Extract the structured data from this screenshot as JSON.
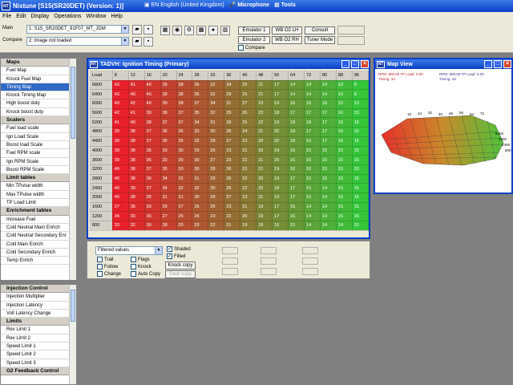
{
  "app": {
    "title": "Nistune [S15(SR20DET) (Version: 1)]",
    "icon": "NT"
  },
  "langbar": {
    "language": "EN English (United Kingdom)",
    "microphone": "Microphone",
    "tools": "Tools"
  },
  "menu": [
    "File",
    "Edit",
    "Display",
    "Operations",
    "Window",
    "Help"
  ],
  "toolbar": {
    "main_label": "Main",
    "compare_label": "Compare",
    "main_value": "1: S15_SR20DET_91F07_MT_JDM",
    "compare_value": "2: Image not loaded",
    "emulator1": "Emulator 1",
    "emulator2": "Emulator 2",
    "wbo2lh": "WB O2 LH",
    "wbo2rh": "WB O2 RH",
    "consult": "Consult",
    "tuner_mode": "Tuner Mode",
    "compare_check": "Compare"
  },
  "sidebar_top": [
    {
      "type": "head",
      "label": "Maps"
    },
    {
      "type": "item",
      "label": "Fuel Map"
    },
    {
      "type": "item",
      "label": "Knock Fuel Map"
    },
    {
      "type": "sel",
      "label": "Timing Map"
    },
    {
      "type": "item",
      "label": "Knock Timing Map"
    },
    {
      "type": "item",
      "label": "High boost duty"
    },
    {
      "type": "item",
      "label": "Knock boost duty"
    },
    {
      "type": "head",
      "label": "Scalers"
    },
    {
      "type": "item",
      "label": "Fuel load scale"
    },
    {
      "type": "item",
      "label": "Ign Load Scale"
    },
    {
      "type": "item",
      "label": "Boost load Scale"
    },
    {
      "type": "item",
      "label": "Fuel RPM scale"
    },
    {
      "type": "item",
      "label": "Ign RPM Scale"
    },
    {
      "type": "item",
      "label": "Boost RPM Scale"
    },
    {
      "type": "head",
      "label": "Limit tables"
    },
    {
      "type": "item",
      "label": "Min TPulse width"
    },
    {
      "type": "item",
      "label": "Max TPulse width"
    },
    {
      "type": "item",
      "label": "TP Load Limit"
    },
    {
      "type": "head",
      "label": "Enrichment tables"
    },
    {
      "type": "item",
      "label": "Increase Fuel"
    },
    {
      "type": "item",
      "label": "Cold Neutral Main Enrich"
    },
    {
      "type": "item",
      "label": "Cold Neutral Secondary Enr"
    },
    {
      "type": "item",
      "label": "Cold Main Enrich"
    },
    {
      "type": "item",
      "label": "Cold Secondary Enrich"
    },
    {
      "type": "item",
      "label": "Temp Enrich"
    }
  ],
  "sidebar_bottom": [
    {
      "type": "head",
      "label": "Injection Control"
    },
    {
      "type": "item",
      "label": "Injection Multiplier"
    },
    {
      "type": "item",
      "label": "Injection Latency"
    },
    {
      "type": "item",
      "label": "Volt Latency Change"
    },
    {
      "type": "head",
      "label": "Limits"
    },
    {
      "type": "item",
      "label": "Rev Limit 1"
    },
    {
      "type": "item",
      "label": "Rev Limit 2"
    },
    {
      "type": "item",
      "label": "Speed Limit 1"
    },
    {
      "type": "item",
      "label": "Speed Limit 2"
    },
    {
      "type": "item",
      "label": "Speed Limit 3"
    },
    {
      "type": "head",
      "label": "O2 Feedback Control"
    }
  ],
  "timing": {
    "title": "TADVH: Ignition Timing (Primary)",
    "corner": "Load",
    "cols": [
      "8",
      "12",
      "16",
      "20",
      "24",
      "28",
      "32",
      "36",
      "40",
      "48",
      "56",
      "64",
      "72",
      "80",
      "88",
      "96",
      "104"
    ],
    "rows": [
      {
        "rpm": "6800",
        "v": [
          "43",
          "41",
          "40",
          "39",
          "38",
          "36",
          "32",
          "34",
          "25",
          "21",
          "17",
          "14",
          "14",
          "14",
          "10",
          "8"
        ]
      },
      {
        "rpm": "6400",
        "v": [
          "43",
          "40",
          "40",
          "39",
          "38",
          "36",
          "32",
          "29",
          "25",
          "21",
          "17",
          "14",
          "14",
          "14",
          "10",
          "8"
        ]
      },
      {
        "rpm": "6000",
        "v": [
          "43",
          "42",
          "40",
          "39",
          "38",
          "37",
          "34",
          "31",
          "27",
          "23",
          "19",
          "16",
          "16",
          "16",
          "15",
          "13"
        ]
      },
      {
        "rpm": "5600",
        "v": [
          "42",
          "41",
          "39",
          "38",
          "37",
          "35",
          "32",
          "29",
          "26",
          "23",
          "18",
          "17",
          "17",
          "17",
          "16",
          "15"
        ]
      },
      {
        "rpm": "5200",
        "v": [
          "41",
          "40",
          "38",
          "37",
          "37",
          "34",
          "31",
          "28",
          "25",
          "22",
          "19",
          "18",
          "18",
          "17",
          "16",
          "15"
        ]
      },
      {
        "rpm": "4800",
        "v": [
          "39",
          "38",
          "37",
          "36",
          "36",
          "33",
          "30",
          "28",
          "24",
          "21",
          "20",
          "18",
          "17",
          "17",
          "16",
          "15"
        ]
      },
      {
        "rpm": "4400",
        "v": [
          "39",
          "38",
          "37",
          "36",
          "35",
          "32",
          "29",
          "27",
          "23",
          "20",
          "20",
          "18",
          "16",
          "17",
          "16",
          "15"
        ]
      },
      {
        "rpm": "4000",
        "v": [
          "39",
          "38",
          "36",
          "33",
          "30",
          "29",
          "25",
          "23",
          "21",
          "20",
          "19",
          "16",
          "15",
          "15",
          "15",
          "15"
        ]
      },
      {
        "rpm": "3600",
        "v": [
          "39",
          "38",
          "36",
          "33",
          "30",
          "30",
          "27",
          "23",
          "22",
          "21",
          "20",
          "16",
          "16",
          "15",
          "15",
          "15"
        ]
      },
      {
        "rpm": "3200",
        "v": [
          "40",
          "38",
          "37",
          "35",
          "33",
          "30",
          "28",
          "26",
          "22",
          "21",
          "19",
          "16",
          "16",
          "15",
          "15",
          "15"
        ]
      },
      {
        "rpm": "2800",
        "v": [
          "40",
          "38",
          "36",
          "34",
          "32",
          "31",
          "29",
          "26",
          "22",
          "20",
          "19",
          "17",
          "15",
          "15",
          "15",
          "15"
        ]
      },
      {
        "rpm": "2400",
        "v": [
          "40",
          "39",
          "37",
          "34",
          "32",
          "32",
          "30",
          "26",
          "22",
          "20",
          "18",
          "17",
          "15",
          "14",
          "15",
          "15"
        ]
      },
      {
        "rpm": "2000",
        "v": [
          "40",
          "38",
          "35",
          "31",
          "31",
          "30",
          "29",
          "27",
          "23",
          "21",
          "19",
          "17",
          "15",
          "14",
          "15",
          "15"
        ]
      },
      {
        "rpm": "1600",
        "v": [
          "37",
          "36",
          "33",
          "29",
          "27",
          "26",
          "25",
          "23",
          "21",
          "19",
          "17",
          "15",
          "14",
          "14",
          "15",
          "15"
        ]
      },
      {
        "rpm": "1200",
        "v": [
          "34",
          "33",
          "30",
          "27",
          "25",
          "24",
          "23",
          "22",
          "20",
          "19",
          "17",
          "15",
          "14",
          "14",
          "15",
          "15"
        ]
      },
      {
        "rpm": "800",
        "v": [
          "33",
          "32",
          "30",
          "28",
          "25",
          "23",
          "22",
          "21",
          "19",
          "18",
          "16",
          "15",
          "14",
          "14",
          "14",
          "15"
        ]
      }
    ]
  },
  "mapview": {
    "title": "Map View",
    "readout1": "RPM: 800.00  TP Load: 0.00",
    "readout2": "Timing: 34",
    "readout3": "RPM: 800.00  TP Load: 0.00",
    "readout4": "Timing: 34",
    "axis_labels": [
      "16",
      "24",
      "32",
      "40",
      "48",
      "56",
      "64",
      "72",
      "80",
      "88",
      "96",
      "104"
    ],
    "rpm_labels": [
      "8400",
      "4800",
      "2400",
      "800"
    ]
  },
  "controls": {
    "filter": "Filtered values",
    "trail": "Trail",
    "follow": "Follow",
    "change": "Change",
    "flags": "Flags",
    "knock": "Knock",
    "autocopy": "Auto Copy",
    "shaded": "Shaded",
    "filled": "Filled",
    "knock_copy": "Knock copy",
    "gear_copy": "Gear copy"
  },
  "colors": {
    "hot": "#e8202c",
    "cold": "#35c63a"
  }
}
